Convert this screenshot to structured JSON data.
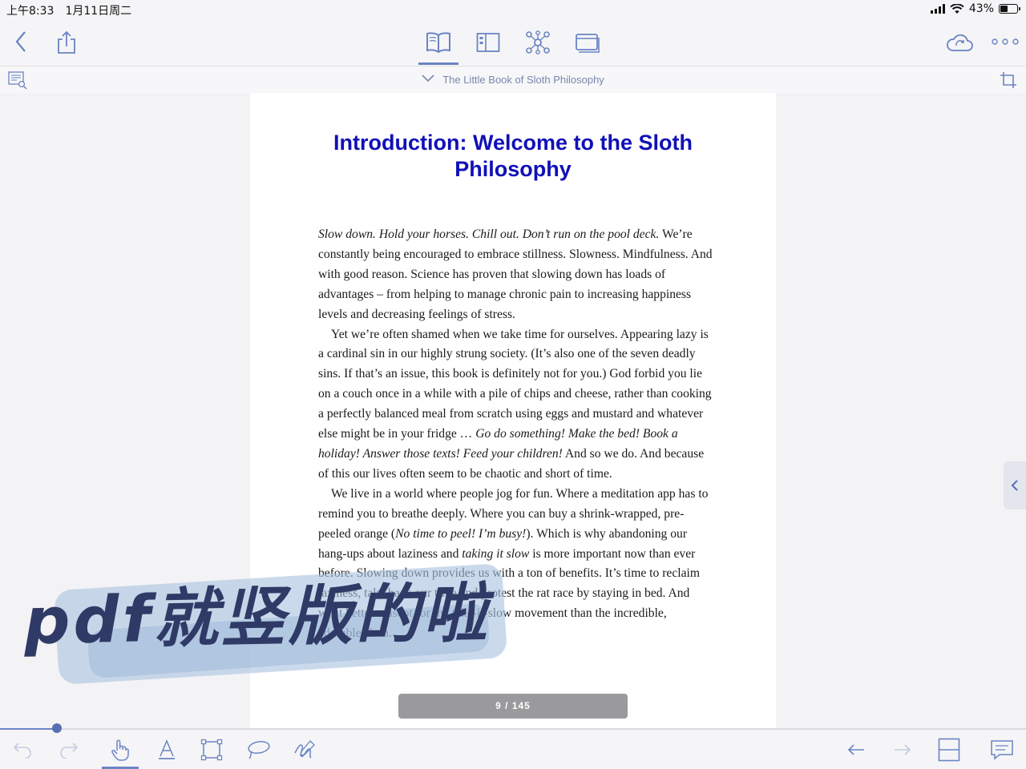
{
  "status_bar": {
    "time": "上午8:33",
    "date": "1月11日周二",
    "battery_percent": "43%",
    "battery_level": 0.43
  },
  "toolbar": {
    "icons": [
      "back-chevron-icon",
      "share-icon",
      "book-icon",
      "grid-icon",
      "mindmap-icon",
      "cards-icon",
      "cloud-sync-icon",
      "more-icon"
    ],
    "accent": "#6a84c4"
  },
  "subbar": {
    "doc_title": "The Little Book of Sloth Philosophy"
  },
  "page": {
    "chapter_title": "Introduction: Welcome to the Sloth Philosophy",
    "p1_italic": "Slow down. Hold your horses. Chill out. Don’t run on the pool deck.",
    "p1_rest": " We’re constantly being encouraged to embrace stillness. Slowness. Mindfulness. And with good reason. Science has proven that slowing down has loads of advantages – from helping to manage chronic pain to increasing happiness levels and decreasing feelings of stress.",
    "p2_a": "Yet we’re often shamed when we take time for ourselves. Appearing lazy is a cardinal sin in our highly strung society. (It’s also one of the seven deadly sins. If that’s an issue, this book is definitely not for you.) God forbid you lie on a couch once in a while with a pile of chips and cheese, rather than cooking a perfectly balanced meal from scratch using eggs and mustard and whatever else might be in your fridge … ",
    "p2_italic": "Go do something! Make the bed! Book a holiday! Answer those texts! Feed your children!",
    "p2_b": " And so we do. And because of this our lives often seem to be chaotic and short of time.",
    "p3_a": "We live in a world where people jog for fun. Where a meditation app has to remind you to breathe deeply. Where you can buy a shrink-wrapped, pre-peeled orange (",
    "p3_italic1": "No time to peel! I’m busy!",
    "p3_b": "). Which is why abandoning our hang-ups about laziness and ",
    "p3_italic2": "taking it slow",
    "p3_c": " is more important now than ever before. Slowing down provides us with a ton of benefits. It’s time to reclaim laziness, take back our time and protest the rat race by staying in bed. And what better mascot for the take-it-slow movement than the incredible, adorable sloth."
  },
  "page_indicator": "9 / 145",
  "reading_progress": {
    "current": 9,
    "total": 145
  },
  "overlay_text": "pdf就竖版的啦",
  "bottom_bar": {
    "tools": [
      "undo-icon",
      "redo-icon",
      "hand-tool-icon",
      "text-tool-icon",
      "shape-tool-icon",
      "lasso-icon",
      "pen-icon"
    ],
    "nav": [
      "prev-page-icon",
      "next-page-icon",
      "layout-icon",
      "comment-icon"
    ],
    "active_tool": "hand-tool-icon"
  }
}
